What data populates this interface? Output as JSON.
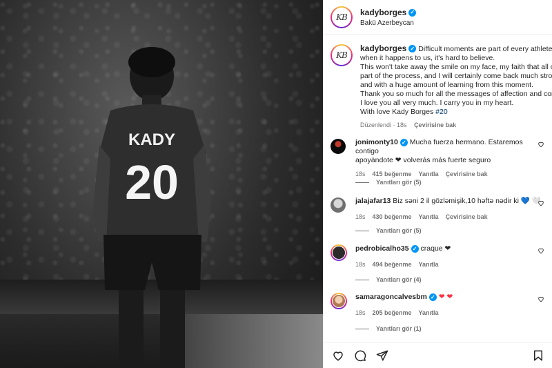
{
  "post": {
    "username": "kadyborges",
    "location": "Bakü Azerbeycan",
    "avatar_text": "KB",
    "jersey_name": "KADY",
    "jersey_number": "20",
    "caption_lines": [
      "Difficult moments are part of every athlete's life, b",
      "when it happens to us, it's hard to believe.",
      "This won't take away the smile on my face, my faith that all of thi",
      "part of the process, and I will certainly come back much stronger",
      "and with a huge amount of learning from this moment.",
      "Thank you so much for all the messages of affection and concern",
      "I love you all very much. I carry you in my heart.",
      "With love Kady Borges"
    ],
    "hashtag": "#20",
    "edited": "Düzenlendi",
    "time": "18s",
    "translate": "Çevirisine bak"
  },
  "comments": [
    {
      "username": "jonimonty10",
      "verified": true,
      "lines": [
        "Mucha fuerza hermano. Estaremos contigo",
        "apoyándote ❤ volverás más fuerte seguro"
      ],
      "time": "18s",
      "likes": "415 beğenme",
      "reply": "Yanıtla",
      "translate": "Çevirisine bak",
      "replies": "Yanıtları gör (5)",
      "avatar_color": "#3a1a1a"
    },
    {
      "username": "jalajafar13",
      "verified": false,
      "lines": [
        "Biz səni 2 il gözləmişik,10 həftə nədir ki 💙 🤍"
      ],
      "time": "18s",
      "likes": "430 beğenme",
      "reply": "Yanıtla",
      "translate": "Çevirisine bak",
      "replies": "Yanıtları gör (5)",
      "avatar_color": "#8c8c8c"
    },
    {
      "username": "pedrobicalho35",
      "verified": true,
      "lines": [
        "craque ❤"
      ],
      "time": "18s",
      "likes": "494 beğenme",
      "reply": "Yanıtla",
      "translate": "",
      "replies": "Yanıtları gör (4)",
      "avatar_color": "#2b2b2b"
    },
    {
      "username": "samaragoncalvesbm",
      "verified": true,
      "lines": [
        "❤ ❤"
      ],
      "time": "18s",
      "likes": "205 beğenme",
      "reply": "Yanıtla",
      "translate": "",
      "replies": "Yanıtları gör (1)",
      "avatar_color": "#c9a27a"
    }
  ],
  "colors": {
    "verified": "#0095f6",
    "heart_red": "#ff3040",
    "muted": "#737373",
    "hashtag": "#00376b"
  },
  "icons": [
    "heart-icon",
    "comment-icon",
    "share-icon",
    "bookmark-icon",
    "verified-badge-icon"
  ]
}
